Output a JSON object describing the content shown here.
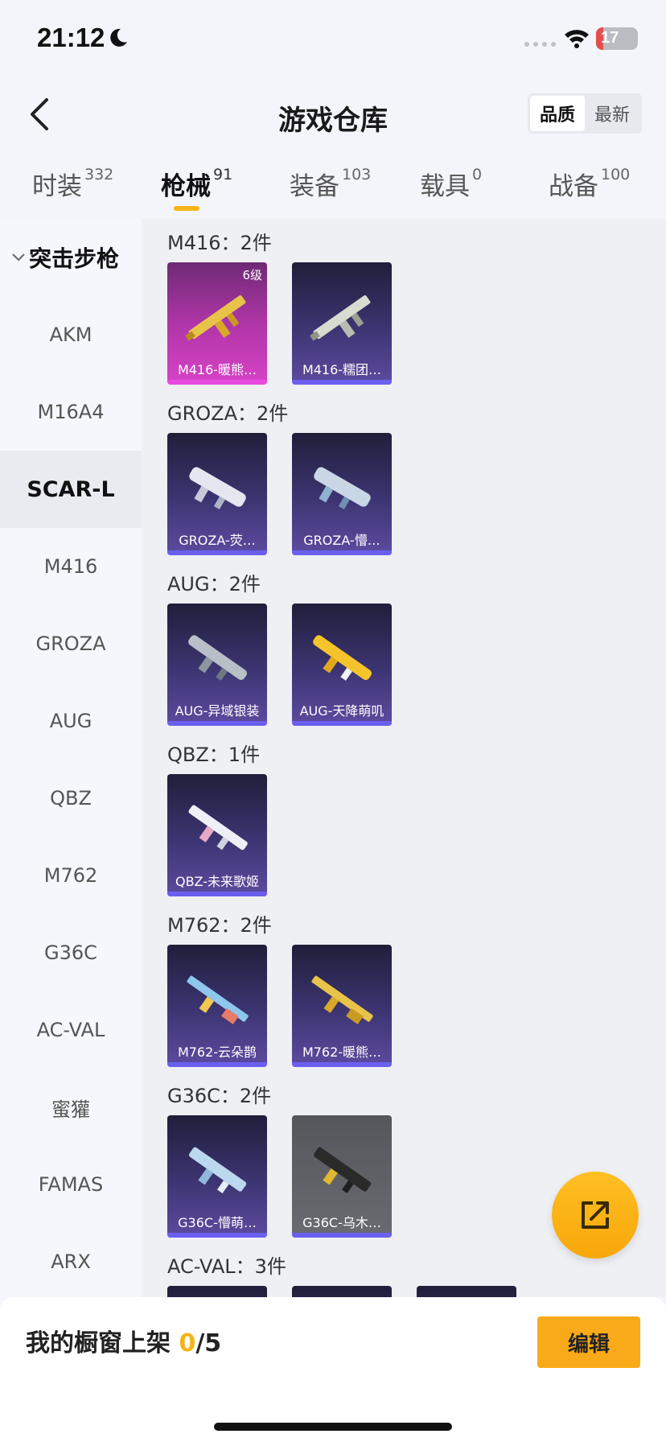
{
  "status": {
    "time": "21:12",
    "battery": "17",
    "battery_level": 0.17
  },
  "header": {
    "title": "游戏仓库",
    "sort_quality": "品质",
    "sort_newest": "最新"
  },
  "tabs": [
    {
      "label": "时装",
      "count": "332"
    },
    {
      "label": "枪械",
      "count": "91"
    },
    {
      "label": "装备",
      "count": "103"
    },
    {
      "label": "载具",
      "count": "0"
    },
    {
      "label": "战备",
      "count": "100"
    }
  ],
  "sidebar": {
    "group": "突击步枪",
    "items": [
      "AKM",
      "M16A4",
      "SCAR-L",
      "M416",
      "GROZA",
      "AUG",
      "QBZ",
      "M762",
      "G36C",
      "AC-VAL",
      "蜜獾",
      "FAMAS",
      "ARX"
    ],
    "active": "SCAR-L"
  },
  "groups": [
    {
      "title": "M416：2件",
      "items": [
        {
          "name": "M416-暖熊…",
          "level": "6级",
          "icon": "gold-rifle-icon"
        },
        {
          "name": "M416-糯团…",
          "icon": "silver-rifle-icon"
        }
      ]
    },
    {
      "title": "GROZA：2件",
      "items": [
        {
          "name": "GROZA-荧…",
          "icon": "bullpup-rifle-icon"
        },
        {
          "name": "GROZA-懵…",
          "icon": "bullpup-rifle-icon"
        }
      ]
    },
    {
      "title": "AUG：2件",
      "items": [
        {
          "name": "AUG-异域银装",
          "icon": "aug-rifle-icon"
        },
        {
          "name": "AUG-天降萌叽",
          "icon": "aug-rifle-icon"
        }
      ]
    },
    {
      "title": "QBZ：1件",
      "items": [
        {
          "name": "QBZ-未来歌姬",
          "icon": "qbz-rifle-icon"
        }
      ]
    },
    {
      "title": "M762：2件",
      "items": [
        {
          "name": "M762-云朵鹊",
          "icon": "m762-rifle-icon"
        },
        {
          "name": "M762-暖熊…",
          "icon": "m762-rifle-icon"
        }
      ]
    },
    {
      "title": "G36C：2件",
      "items": [
        {
          "name": "G36C-懵萌…",
          "icon": "g36c-rifle-icon"
        },
        {
          "name": "G36C-乌木…",
          "icon": "g36c-rifle-icon"
        }
      ]
    },
    {
      "title": "AC-VAL：3件",
      "items": [
        {
          "name": "",
          "icon": "rifle-icon"
        },
        {
          "name": "",
          "icon": "rifle-icon"
        },
        {
          "name": "",
          "icon": "rifle-icon"
        }
      ]
    }
  ],
  "bottom": {
    "shelf_text": "我的橱窗上架 ",
    "shelf_current": "0",
    "shelf_total": "/5",
    "edit": "编辑"
  },
  "colors": {
    "accent": "#f5b418",
    "edit_button": "#f9aa18",
    "card_purple": "#3d3573",
    "card_orange": "#d743c6"
  }
}
